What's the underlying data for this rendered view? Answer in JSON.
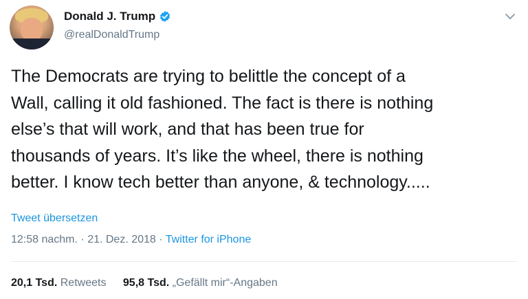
{
  "user": {
    "display_name": "Donald J. Trump",
    "handle": "@realDonaldTrump",
    "verified": true
  },
  "tweet": {
    "lines": [
      "The Democrats are trying to belittle the concept of a",
      "Wall, calling it old fashioned. The fact is there is nothing",
      "else’s that will work, and that has been true for",
      "thousands of years. It’s like the wheel, there is nothing",
      "better. I know tech better than anyone, & technology....."
    ],
    "translate_label": "Tweet übersetzen",
    "time": "12:58 nachm.",
    "date": "21. Dez. 2018",
    "separator": "·",
    "source": "Twitter for iPhone"
  },
  "stats": {
    "retweets_count": "20,1 Tsd.",
    "retweets_label": "Retweets",
    "likes_count": "95,8 Tsd.",
    "likes_label": "„Gefällt mir“-Angaben"
  },
  "colors": {
    "link": "#1b95e0",
    "secondary_text": "#657786",
    "primary_text": "#14171a",
    "verified_badge": "#1da1f2",
    "divider": "#e6ecf0"
  },
  "icons": {
    "verified": "verified-badge-icon",
    "menu": "chevron-down-icon"
  }
}
